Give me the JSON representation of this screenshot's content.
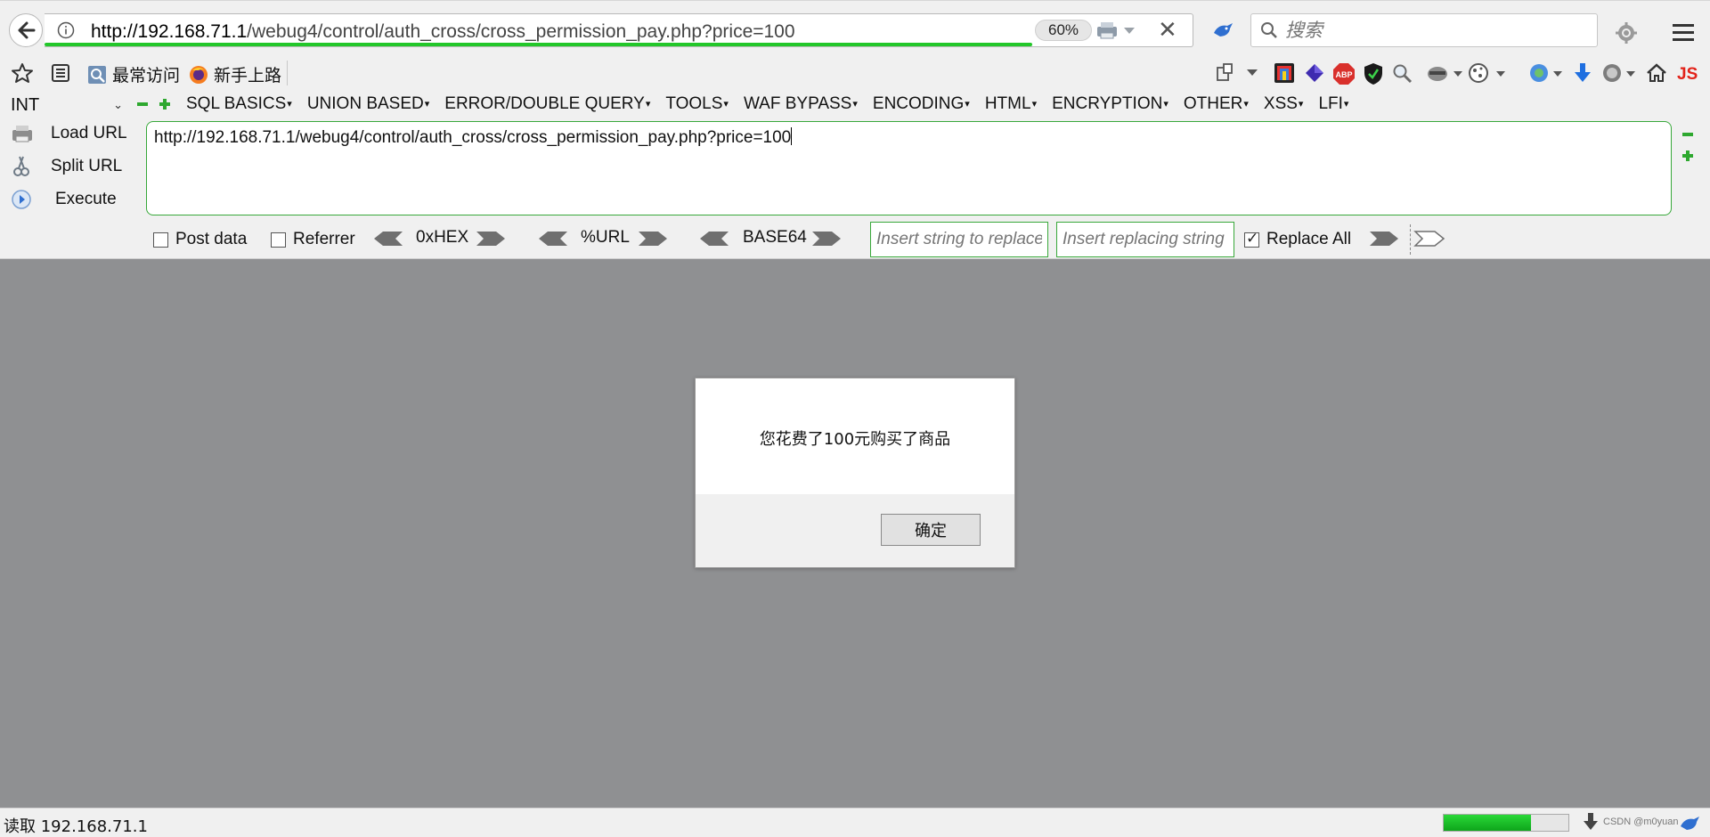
{
  "navbar": {
    "url_host": "http://192.168.71.1",
    "url_path": "/webug4/control/auth_cross/cross_permission_pay.php?price=100",
    "zoom": "60%",
    "search_placeholder": "搜索",
    "load_progress": 0.86
  },
  "bookmarks": [
    {
      "label": "最常访问",
      "icon": "bookmark-folder-icon"
    },
    {
      "label": "新手上路",
      "icon": "firefox-icon"
    }
  ],
  "hackbar": {
    "type_select": "INT",
    "menus": [
      "SQL BASICS",
      "UNION BASED",
      "ERROR/DOUBLE QUERY",
      "TOOLS",
      "WAF BYPASS",
      "ENCODING",
      "HTML",
      "ENCRYPTION",
      "OTHER",
      "XSS",
      "LFI"
    ],
    "load_url": "Load URL",
    "split_url": "Split URL",
    "execute": "Execute",
    "url_value": "http://192.168.71.1/webug4/control/auth_cross/cross_permission_pay.php?price=100",
    "post_data": "Post data",
    "referrer": "Referrer",
    "encoders": [
      "0xHEX",
      "%URL",
      "BASE64"
    ],
    "replace_placeholder": "Insert string to replace",
    "replacing_placeholder": "Insert replacing string",
    "replace_all": "Replace All",
    "post_data_checked": false,
    "referrer_checked": false,
    "replace_all_checked": true
  },
  "dialog": {
    "message": "您花费了100元购买了商品",
    "ok_label": "确定"
  },
  "statusbar": {
    "text": "读取 192.168.71.1",
    "progress": 0.7,
    "watermark": "CSDN @m0yuan"
  },
  "colors": {
    "accent_green": "#38a83a",
    "page_overlay": "#8f9092",
    "progress_green": "#23c72a"
  }
}
